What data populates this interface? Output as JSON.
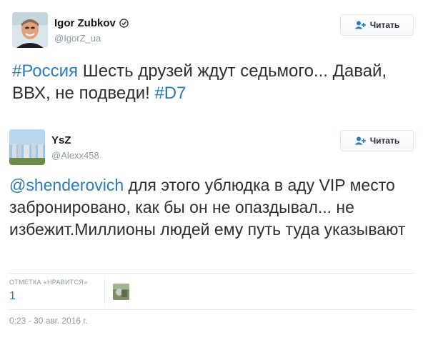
{
  "tweet1": {
    "name": "Igor Zubkov",
    "handle": "@IgorZ_ua",
    "follow_label": "Читать",
    "text_parts": [
      "#Россия",
      " Шесть друзей ждут седьмого... Давай, ВВХ, не подведи! ",
      "#D7"
    ]
  },
  "tweet2": {
    "name": "YsZ",
    "handle": "@Alexx458",
    "follow_label": "Читать",
    "text_parts": [
      "@shenderovich",
      " для этого ублюдка в аду VIP место забронировано, как бы он не опаздывал... не избежит.Миллионы людей ему путь туда  указывают"
    ],
    "likes_label": "ОТМЕТКА «НРАВИТСЯ»",
    "likes_count": "1",
    "timestamp": "0:23 - 30 авг. 2016 г."
  },
  "colors": {
    "link": "#2b7bb9",
    "muted": "#8899a6",
    "text": "#292f33",
    "border": "#e1e8ed"
  },
  "icons": {
    "verified": "verified-badge-icon",
    "follow": "add-user-icon"
  }
}
